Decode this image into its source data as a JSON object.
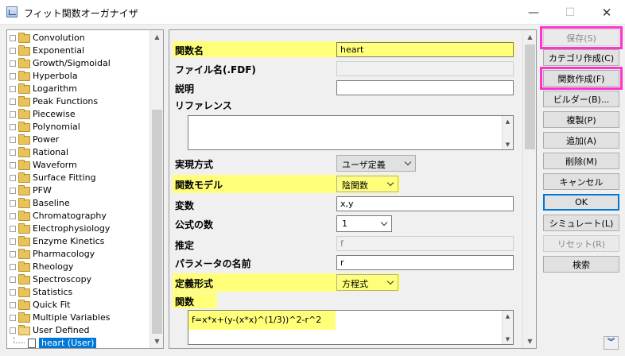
{
  "window": {
    "title": "フィット関数オーガナイザ",
    "minimize": "—",
    "maximize": "☐",
    "close": "✕"
  },
  "tree": {
    "items": [
      {
        "label": "Convolution",
        "type": "folder"
      },
      {
        "label": "Exponential",
        "type": "folder"
      },
      {
        "label": "Growth/Sigmoidal",
        "type": "folder"
      },
      {
        "label": "Hyperbola",
        "type": "folder"
      },
      {
        "label": "Logarithm",
        "type": "folder"
      },
      {
        "label": "Peak Functions",
        "type": "folder"
      },
      {
        "label": "Piecewise",
        "type": "folder"
      },
      {
        "label": "Polynomial",
        "type": "folder"
      },
      {
        "label": "Power",
        "type": "folder"
      },
      {
        "label": "Rational",
        "type": "folder"
      },
      {
        "label": "Waveform",
        "type": "folder"
      },
      {
        "label": "Surface Fitting",
        "type": "folder"
      },
      {
        "label": "PFW",
        "type": "folder"
      },
      {
        "label": "Baseline",
        "type": "folder"
      },
      {
        "label": "Chromatography",
        "type": "folder"
      },
      {
        "label": "Electrophysiology",
        "type": "folder"
      },
      {
        "label": "Enzyme Kinetics",
        "type": "folder"
      },
      {
        "label": "Pharmacology",
        "type": "folder"
      },
      {
        "label": "Rheology",
        "type": "folder"
      },
      {
        "label": "Spectroscopy",
        "type": "folder"
      },
      {
        "label": "Statistics",
        "type": "folder"
      },
      {
        "label": "Quick Fit",
        "type": "folder"
      },
      {
        "label": "Multiple Variables",
        "type": "folder"
      },
      {
        "label": "User Defined",
        "type": "folder-open"
      },
      {
        "label": "heart (User)",
        "type": "file",
        "selected": true
      }
    ]
  },
  "form": {
    "function_name_label": "関数名",
    "function_name_value": "heart",
    "file_name_label": "ファイル名(.FDF)",
    "file_name_value": "",
    "description_label": "説明",
    "description_value": "",
    "reference_label": "リファレンス",
    "reference_value": "",
    "implementation_label": "実現方式",
    "implementation_value": "ユーザ定義",
    "function_model_label": "関数モデル",
    "function_model_value": "陰関数",
    "variables_label": "変数",
    "variables_value": "x,y",
    "formula_count_label": "公式の数",
    "formula_count_value": "1",
    "estimate_label": "推定",
    "estimate_value": "f",
    "param_names_label": "パラメータの名前",
    "param_names_value": "r",
    "definition_form_label": "定義形式",
    "definition_form_value": "方程式",
    "function_label": "関数",
    "function_body": "f=x*x+(y-(x*x)^(1/3))^2-r^2"
  },
  "buttons": {
    "save": "保存(S)",
    "create_category": "カテゴリ作成(C)",
    "create_function": "関数作成(F)",
    "builder": "ビルダー(B)...",
    "duplicate": "複製(P)",
    "add": "追加(A)",
    "delete": "削除(M)",
    "cancel": "キャンセル",
    "ok": "OK",
    "simulate": "シミュレート(L)",
    "reset": "リセット(R)",
    "search": "検索"
  },
  "colors": {
    "highlight": "#ffff7a",
    "pink_outline": "#ff33cc",
    "selection": "#0078d7"
  }
}
